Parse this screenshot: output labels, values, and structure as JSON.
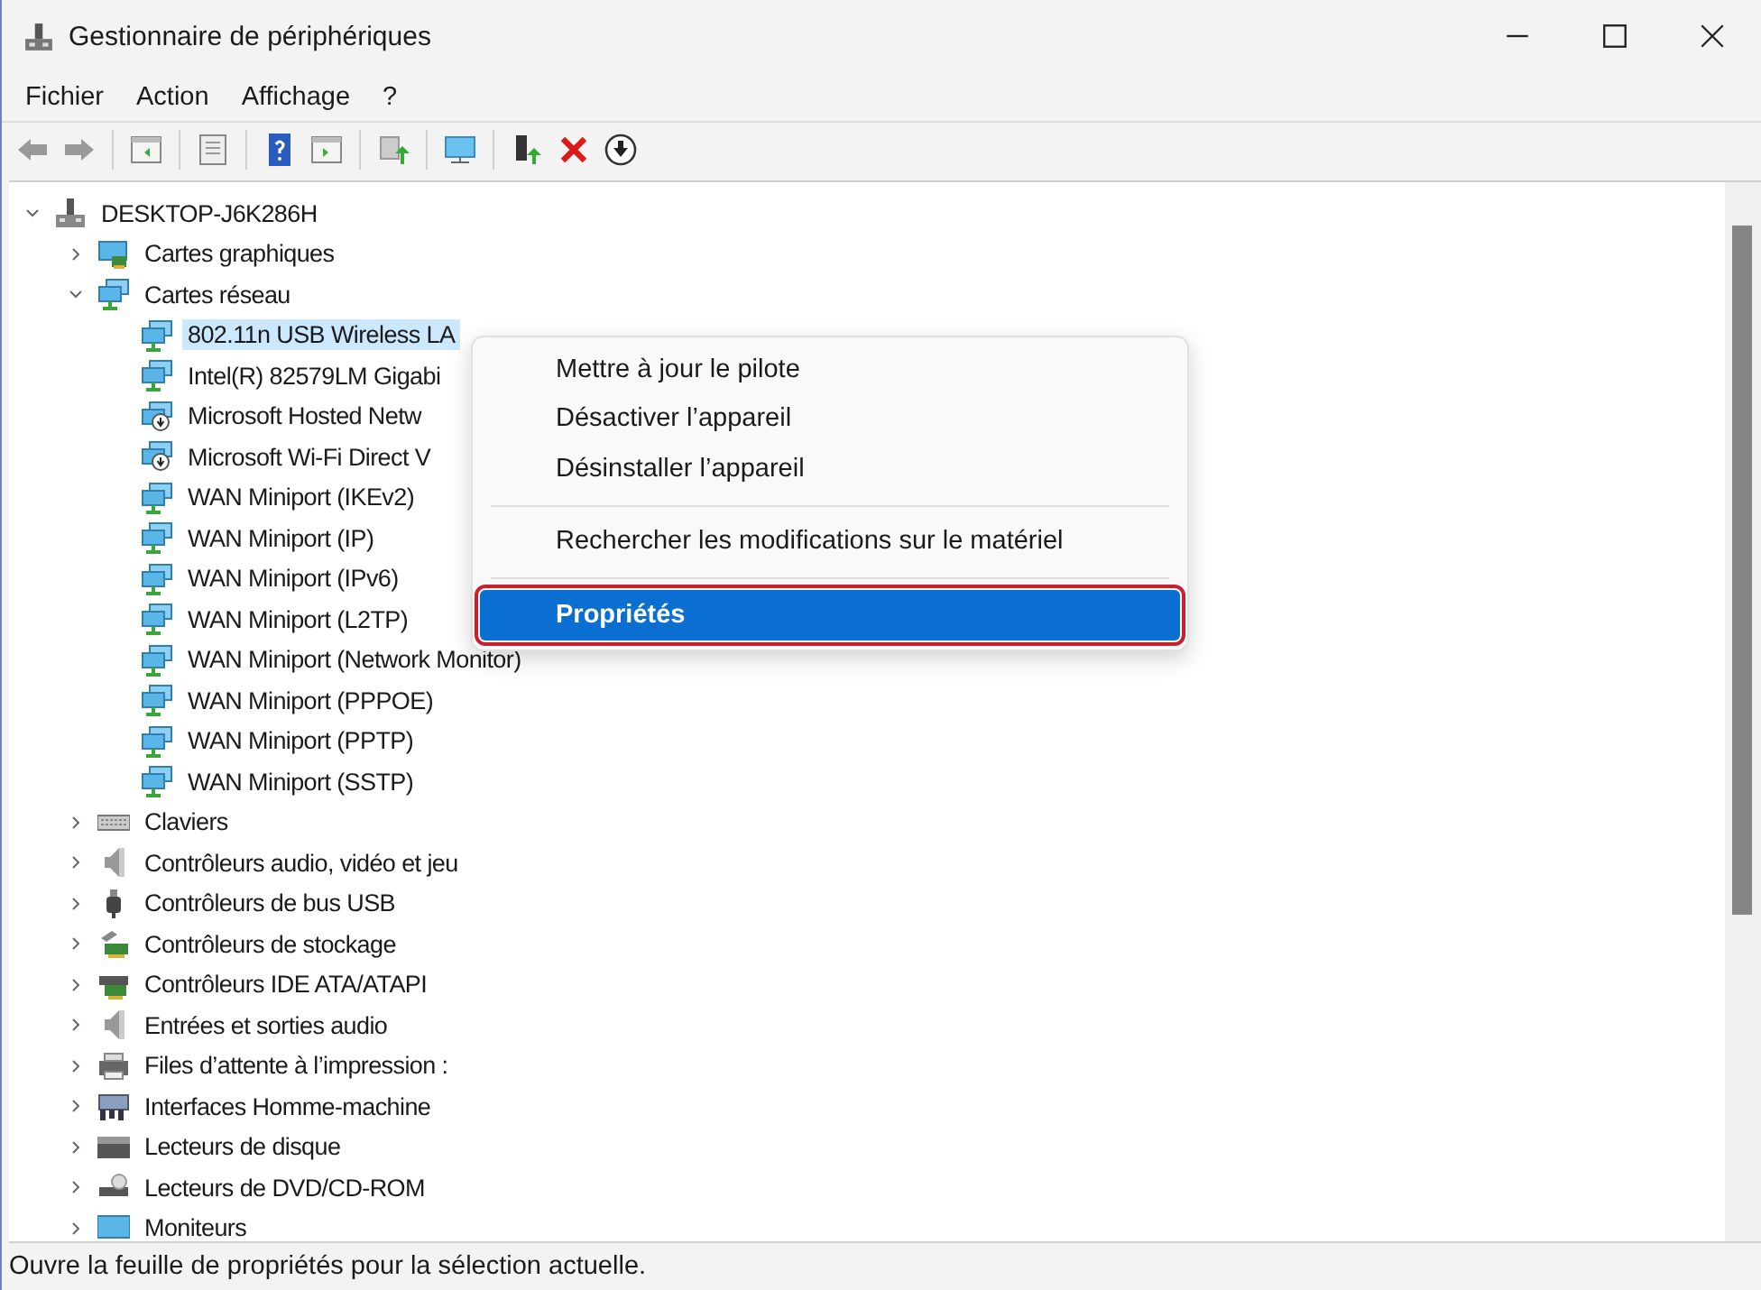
{
  "window": {
    "title": "Gestionnaire de périphériques"
  },
  "menu_bar": [
    "Fichier",
    "Action",
    "Affichage",
    "?"
  ],
  "tree": [
    {
      "label": "DESKTOP-J6K286H",
      "kind": "computer",
      "expanded": true,
      "selected": false,
      "children": [
        {
          "label": "Cartes graphiques",
          "kind": "display",
          "expanded": false,
          "selected": false
        },
        {
          "label": "Cartes réseau",
          "kind": "network",
          "expanded": true,
          "selected": false,
          "children": [
            {
              "label": "802.11n USB Wireless LA",
              "kind": "network",
              "selected": true
            },
            {
              "label": "Intel(R) 82579LM Gigabi",
              "kind": "network",
              "selected": false
            },
            {
              "label": "Microsoft Hosted Netw",
              "kind": "virtual-network",
              "selected": false
            },
            {
              "label": "Microsoft Wi-Fi Direct V",
              "kind": "virtual-network",
              "selected": false
            },
            {
              "label": "WAN Miniport (IKEv2)",
              "kind": "network",
              "selected": false
            },
            {
              "label": "WAN Miniport (IP)",
              "kind": "network",
              "selected": false
            },
            {
              "label": "WAN Miniport (IPv6)",
              "kind": "network",
              "selected": false
            },
            {
              "label": "WAN Miniport (L2TP)",
              "kind": "network",
              "selected": false
            },
            {
              "label": "WAN Miniport (Network Monitor)",
              "kind": "network",
              "selected": false
            },
            {
              "label": "WAN Miniport (PPPOE)",
              "kind": "network",
              "selected": false
            },
            {
              "label": "WAN Miniport (PPTP)",
              "kind": "network",
              "selected": false
            },
            {
              "label": "WAN Miniport (SSTP)",
              "kind": "network",
              "selected": false
            }
          ]
        },
        {
          "label": "Claviers",
          "kind": "keyboard",
          "expanded": false,
          "selected": false
        },
        {
          "label": "Contrôleurs audio, vidéo et jeu",
          "kind": "audio",
          "expanded": false,
          "selected": false
        },
        {
          "label": "Contrôleurs de bus USB",
          "kind": "usb",
          "expanded": false,
          "selected": false
        },
        {
          "label": "Contrôleurs de stockage",
          "kind": "storage",
          "expanded": false,
          "selected": false
        },
        {
          "label": "Contrôleurs IDE ATA/ATAPI",
          "kind": "ide",
          "expanded": false,
          "selected": false
        },
        {
          "label": "Entrées et sorties audio",
          "kind": "audio",
          "expanded": false,
          "selected": false
        },
        {
          "label": "Files d’attente à l’impression :",
          "kind": "printer",
          "expanded": false,
          "selected": false
        },
        {
          "label": "Interfaces Homme-machine",
          "kind": "hid",
          "expanded": false,
          "selected": false
        },
        {
          "label": "Lecteurs de disque",
          "kind": "disk",
          "expanded": false,
          "selected": false
        },
        {
          "label": "Lecteurs de DVD/CD-ROM",
          "kind": "dvd",
          "expanded": false,
          "selected": false
        },
        {
          "label": "Moniteurs",
          "kind": "monitor",
          "expanded": false,
          "selected": false
        }
      ]
    }
  ],
  "context_menu": [
    {
      "kind": "item",
      "label": "Mettre à jour le pilote",
      "selected": false,
      "outlined": false
    },
    {
      "kind": "item",
      "label": "Désactiver l’appareil",
      "selected": false,
      "outlined": false
    },
    {
      "kind": "item",
      "label": "Désinstaller l’appareil",
      "selected": false,
      "outlined": false
    },
    {
      "kind": "separator"
    },
    {
      "kind": "item",
      "label": "Rechercher les modifications sur le matériel",
      "selected": false,
      "outlined": false
    },
    {
      "kind": "separator"
    },
    {
      "kind": "item",
      "label": "Propriétés",
      "selected": true,
      "outlined": true
    }
  ],
  "status_bar": "Ouvre la feuille de propriétés pour la sélection actuelle."
}
